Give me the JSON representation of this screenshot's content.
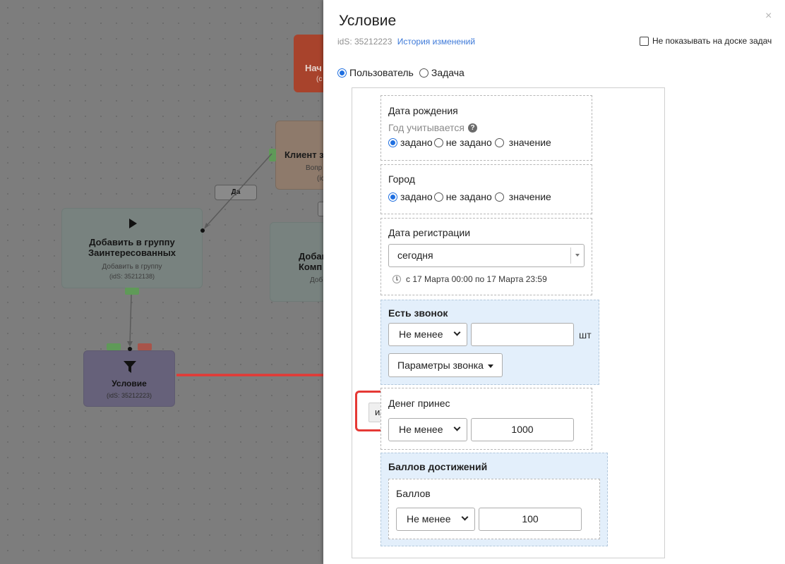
{
  "canvas": {
    "start_node": {
      "title": "Нач",
      "subtitle": "(с"
    },
    "client_node": {
      "title": "Клиент з",
      "subtitle": "Вопр",
      "ids": "(ic"
    },
    "add_group_node": {
      "title": "Добавить в группу Заинтересованных",
      "subtitle": "Добавить в группу",
      "ids": "(idS: 35212138)"
    },
    "add_node2": {
      "title_line1": "Добав",
      "title_line2": "Комп",
      "subtitle": "Доб"
    },
    "condition_node": {
      "title": "Условие",
      "ids": "(idS: 35212223)"
    },
    "edge_label": "Да"
  },
  "modal": {
    "title": "Условие",
    "close_icon": "×",
    "ids_text": "idS: 35212223",
    "history_link": "История изменений",
    "hide_checkbox_label": "Не показывать на доске задач",
    "target_options": [
      {
        "label": "Пользователь",
        "selected": true
      },
      {
        "label": "Задача",
        "selected": false
      }
    ],
    "or_button": "или",
    "conditions": {
      "birthday": {
        "title": "Дата рождения",
        "subtitle": "Год учитывается",
        "options": [
          "задано",
          "не задано",
          "значение"
        ],
        "selected": "задано"
      },
      "city": {
        "title": "Город",
        "options": [
          "задано",
          "не задано",
          "значение"
        ],
        "selected": "задано"
      },
      "registration": {
        "title": "Дата регистрации",
        "select_value": "сегодня",
        "range": "с 17 Марта 00:00 по 17 Марта 23:59"
      },
      "call": {
        "title": "Есть звонок",
        "operator": "Не менее",
        "value": "",
        "unit": "шт",
        "params_button": "Параметры звонка"
      },
      "money": {
        "title": "Денег принес",
        "operator": "Не менее",
        "value": "1000"
      },
      "achievements": {
        "title": "Баллов достижений",
        "inner_title": "Баллов",
        "operator": "Не менее",
        "value": "100"
      }
    }
  },
  "colors": {
    "accent": "#1f6fe0",
    "link": "#3d79d8",
    "highlight_red": "#e53935",
    "blue_box": "#e3effb"
  }
}
